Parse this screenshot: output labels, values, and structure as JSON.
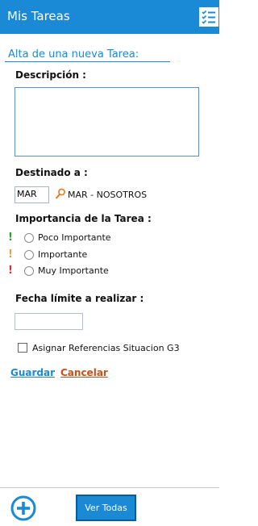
{
  "header": {
    "title": "Mis Tareas",
    "icon": "task-list-icon"
  },
  "form": {
    "heading": "Alta de una nueva Tarea:",
    "description_label": "Descripción :",
    "description_value": "",
    "destinado_label": "Destinado a :",
    "destinado_code": "MAR",
    "destinado_name": "MAR - NOSOTROS",
    "importancia_label": "Importancia de la Tarea :",
    "importancia_options": [
      {
        "mark": "!",
        "label": "Poco Importante",
        "color": "#23a323"
      },
      {
        "mark": "!",
        "label": "Importante",
        "color": "#e8a33c"
      },
      {
        "mark": "!",
        "label": "Muy Importante",
        "color": "#d9342b"
      }
    ],
    "fecha_label": "Fecha límite a realizar :",
    "fecha_value": "",
    "checkbox_label": "Asignar Referencias Situacion G3"
  },
  "actions": {
    "guardar": "Guardar",
    "cancelar": "Cancelar"
  },
  "footer": {
    "ver_todas": "Ver Todas",
    "add_icon": "add-circle-icon"
  },
  "colors": {
    "accent": "#1a8ad6",
    "cancel": "#c9501c"
  }
}
